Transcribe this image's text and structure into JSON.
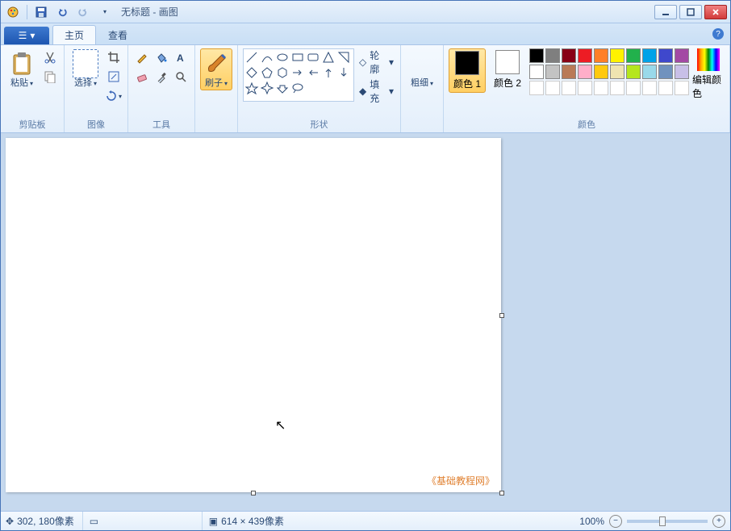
{
  "title": {
    "document": "无标题",
    "app": "画图",
    "sep": " - "
  },
  "tabs": {
    "file_icon": "☰",
    "home": "主页",
    "view": "查看"
  },
  "ribbon": {
    "clipboard": {
      "paste": "粘贴",
      "label": "剪贴板"
    },
    "image": {
      "select": "选择",
      "label": "图像"
    },
    "tools": {
      "label": "工具"
    },
    "brush": {
      "label": "刷子"
    },
    "shapes": {
      "outline": "轮廓",
      "fill": "填充",
      "label": "形状"
    },
    "stroke": {
      "label": "粗细"
    },
    "colors": {
      "c1": "颜色 1",
      "c2": "颜色 2",
      "edit": "编辑颜色",
      "label": "颜色"
    }
  },
  "palette_row1": [
    "#000000",
    "#7f7f7f",
    "#880015",
    "#ed1c24",
    "#ff7f27",
    "#fff200",
    "#22b14c",
    "#00a2e8",
    "#3f48cc",
    "#a349a4"
  ],
  "palette_row2": [
    "#ffffff",
    "#c3c3c3",
    "#b97a57",
    "#ffaec9",
    "#ffc90e",
    "#efe4b0",
    "#b5e61d",
    "#99d9ea",
    "#7092be",
    "#c8bfe7"
  ],
  "canvas": {
    "watermark": "《基础教程网》"
  },
  "status": {
    "pos_icon": "✥",
    "pos": "302, 180像素",
    "sel_icon": "▭",
    "size_icon": "▣",
    "size": "614 × 439像素",
    "zoom": "100%"
  }
}
